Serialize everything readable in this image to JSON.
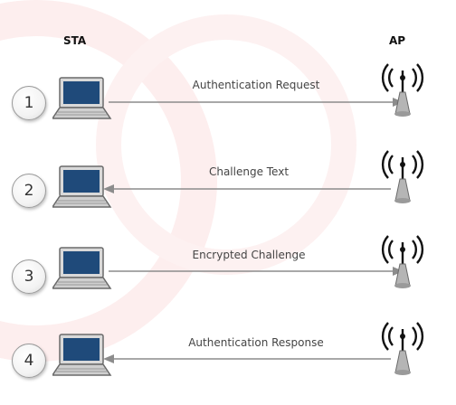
{
  "headers": {
    "sta": "STA",
    "ap": "AP"
  },
  "steps": [
    {
      "number": "1",
      "label": "Authentication Request",
      "direction": "sta-to-ap"
    },
    {
      "number": "2",
      "label": "Challenge Text",
      "direction": "ap-to-sta"
    },
    {
      "number": "3",
      "label": "Encrypted Challenge",
      "direction": "sta-to-ap"
    },
    {
      "number": "4",
      "label": "Authentication Response",
      "direction": "ap-to-sta"
    }
  ],
  "colors": {
    "line": "#8c8c8c",
    "laptop_screen": "#1f4a7a",
    "laptop_body": "#cfcfcf",
    "ap_body": "#b5b5b5",
    "watermark": "#fbe3e3"
  },
  "icons": {
    "station": "laptop-icon",
    "access_point": "wireless-ap-icon"
  }
}
